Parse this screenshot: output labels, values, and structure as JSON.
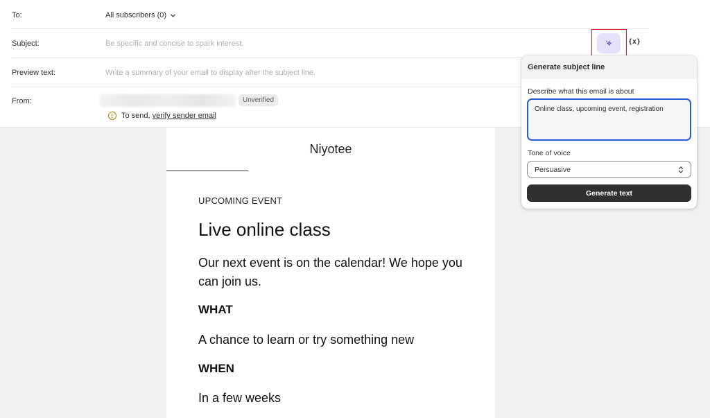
{
  "form": {
    "to": {
      "label": "To:",
      "value": "All subscribers (0)"
    },
    "subject": {
      "label": "Subject:",
      "placeholder": "Be specific and concise to spark interest."
    },
    "preview": {
      "label": "Preview text:",
      "placeholder": "Write a summary of your email to display after the subject line."
    },
    "from": {
      "label": "From:",
      "badge": "Unverified",
      "warning_prefix": "To send, ",
      "warning_link": "verify sender email"
    }
  },
  "toolbar": {
    "variables_icon": "{x}"
  },
  "popover": {
    "title": "Generate subject line",
    "describe_label": "Describe what this email is about",
    "describe_value": "Online class, upcoming event, registration",
    "tone_label": "Tone of voice",
    "tone_value": "Persuasive",
    "generate_label": "Generate text"
  },
  "email": {
    "brand": "Niyotee",
    "eyebrow": "UPCOMING EVENT",
    "headline": "Live online class",
    "lead": "Our next event is on the calendar! We hope you can join us.",
    "what_heading": "WHAT",
    "what_text": "A chance to learn or try something new",
    "when_heading": "WHEN",
    "when_text": "In a few weeks"
  },
  "colors": {
    "accent_ai": "#6d4fd8",
    "ai_button_bg": "#e6e1fb",
    "highlight_border": "#e01b1b",
    "focus_ring": "#2b5bd7",
    "primary_button": "#303030",
    "warning": "#b28400"
  }
}
